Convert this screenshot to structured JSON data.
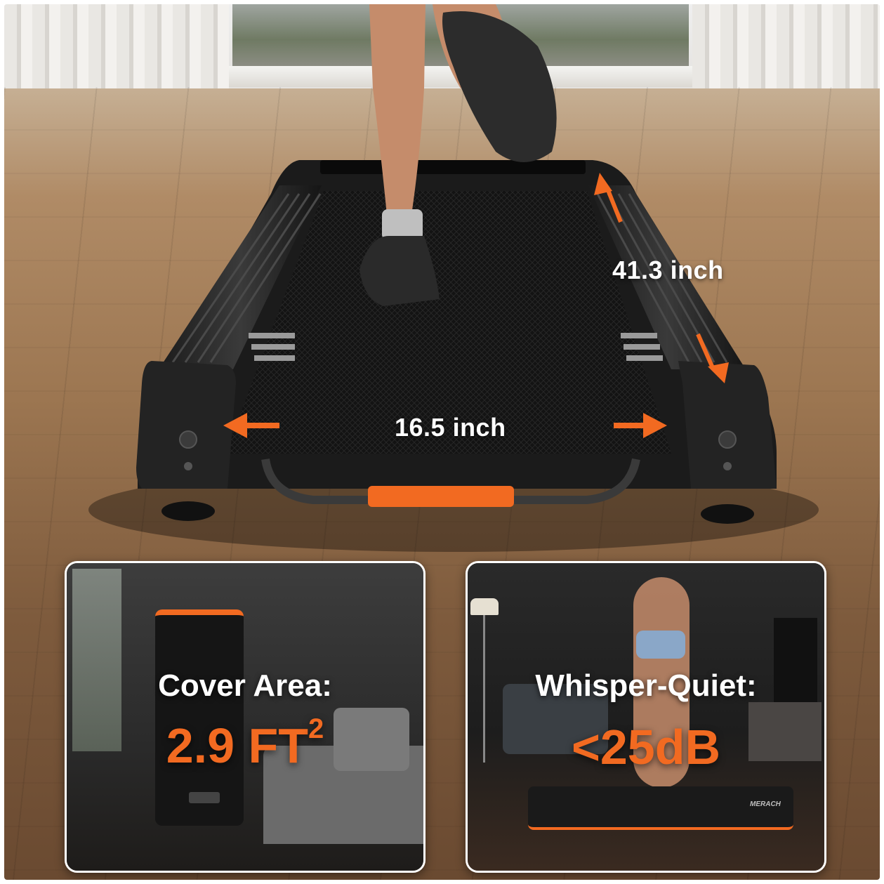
{
  "image": {
    "subject": "walking pad treadmill",
    "accent_color": "#f26a21",
    "frame_color": "#1b1b1b",
    "belt_color": "#141414"
  },
  "dimensions": {
    "length_label": "41.3 inch",
    "width_label": "16.5 inch"
  },
  "panels": [
    {
      "label": "Cover Area:",
      "value": "2.9 FT",
      "superscript": "2"
    },
    {
      "label": "Whisper-Quiet:",
      "value": "<25dB"
    }
  ],
  "brand_mark": "MERACH"
}
